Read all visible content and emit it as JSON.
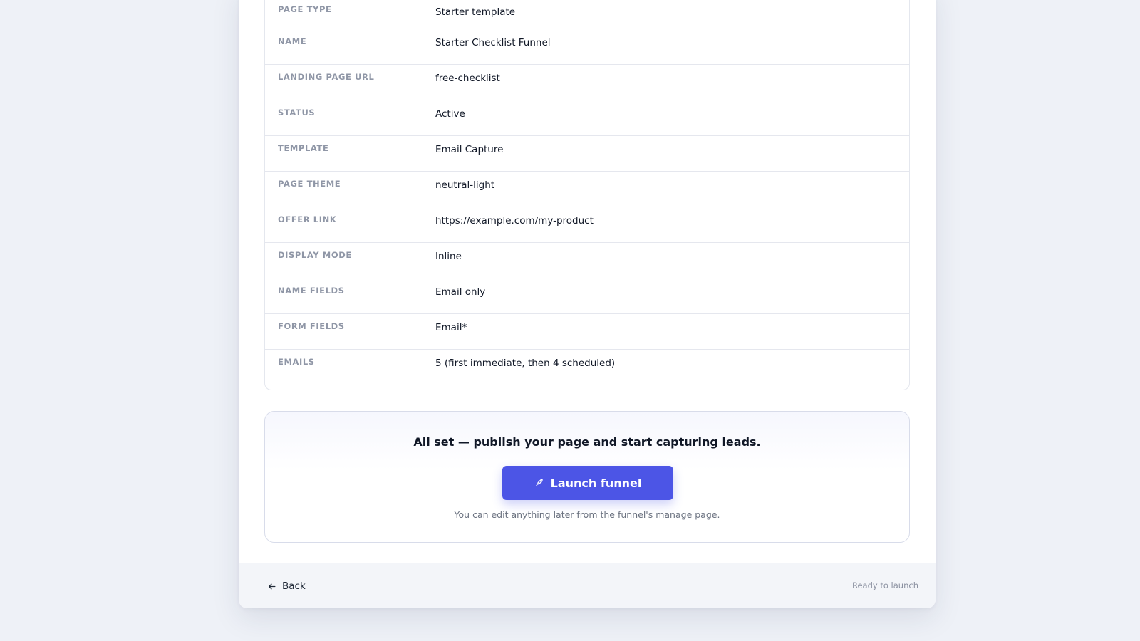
{
  "summary": {
    "rows": [
      {
        "label": "PAGE TYPE",
        "value": "Starter template"
      },
      {
        "label": "NAME",
        "value": "Starter Checklist Funnel"
      },
      {
        "label": "LANDING PAGE URL",
        "value": "free-checklist"
      },
      {
        "label": "STATUS",
        "value": "Active"
      },
      {
        "label": "TEMPLATE",
        "value": "Email Capture"
      },
      {
        "label": "PAGE THEME",
        "value": "neutral-light"
      },
      {
        "label": "OFFER LINK",
        "value": "https://example.com/my-product"
      },
      {
        "label": "DISPLAY MODE",
        "value": "Inline"
      },
      {
        "label": "NAME FIELDS",
        "value": "Email only"
      },
      {
        "label": "FORM FIELDS",
        "value": "Email*"
      },
      {
        "label": "EMAILS",
        "value": "5 (first immediate, then 4 scheduled)"
      }
    ]
  },
  "cta": {
    "heading": "All set — publish your page and start capturing leads.",
    "launch_label": "Launch funnel",
    "launch_icon": "rocket-icon",
    "note": "You can edit anything later from the funnel's manage page."
  },
  "footer": {
    "back_label": "Back",
    "back_icon": "arrow-left-icon",
    "status": "Ready to launch"
  },
  "colors": {
    "page_background": "#eef1f7",
    "accent": "#4c55e6",
    "label_text": "#8f96a6",
    "value_text": "#111827"
  }
}
